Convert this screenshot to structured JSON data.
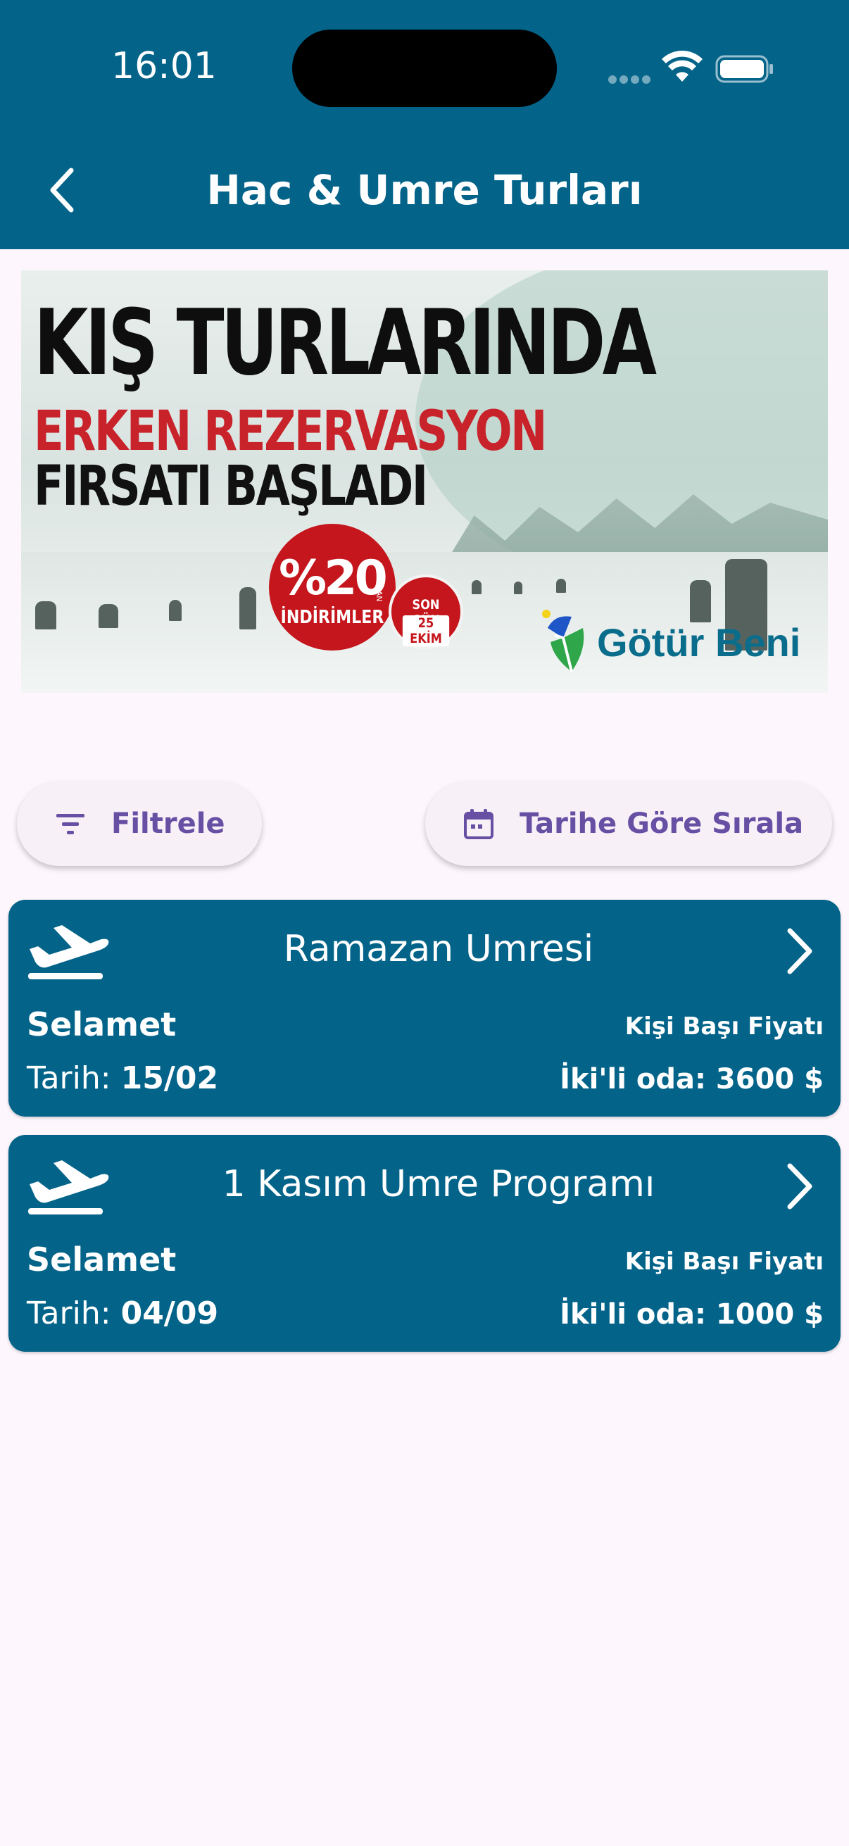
{
  "status_bar": {
    "time": "16:01"
  },
  "app_bar": {
    "title": "Hac & Umre Turları",
    "back_icon": "chevron-left-icon"
  },
  "banner": {
    "line1": "KIŞ TURLARINDA",
    "line2": "ERKEN REZERVASYON",
    "line3": "FIRSATI BAŞLADI",
    "discount": "%20",
    "discount_suffix": "YE VARAN",
    "discount_label": "İNDİRİMLER",
    "deadline_top": "SON GÜN",
    "deadline_date": "25 EKİM",
    "brand": "Götür Beni",
    "colors": {
      "headline_red": "#c8232b",
      "brand_teal": "#0b6d8c"
    }
  },
  "actions": {
    "filter_label": "Filtrele",
    "filter_icon": "filter-icon",
    "sort_label": "Tarihe Göre Sırala",
    "sort_icon": "calendar-icon",
    "color": "#6750A4"
  },
  "tours": [
    {
      "title": "Ramazan Umresi",
      "company": "Selamet",
      "price_label": "Kişi Başı Fiyatı",
      "date_label": "Tarih:",
      "date": "15/02",
      "price": "İki'li oda: 3600 $"
    },
    {
      "title": "1 Kasım Umre Programı",
      "company": "Selamet",
      "price_label": "Kişi Başı Fiyatı",
      "date_label": "Tarih:",
      "date": "04/09",
      "price": "İki'li oda: 1000 $"
    }
  ],
  "theme": {
    "primary": "#036389",
    "background": "#FDF7FD"
  }
}
